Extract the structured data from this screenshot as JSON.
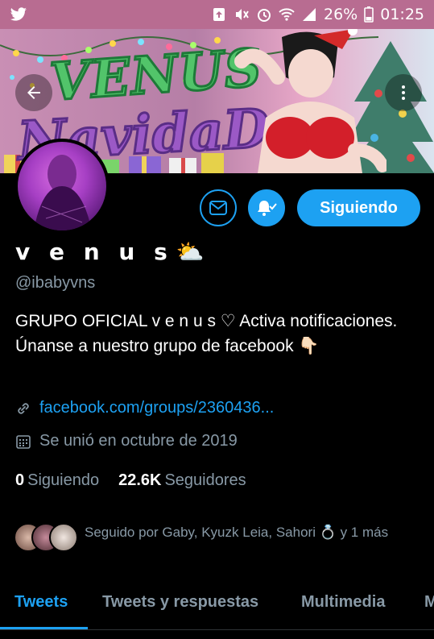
{
  "status_bar": {
    "battery": "26%",
    "time": "01:25",
    "icons": [
      "twitter-bird-icon",
      "upload-icon",
      "mute-icon",
      "alarm-icon",
      "wifi-icon",
      "signal-icon",
      "battery-icon"
    ]
  },
  "banner": {
    "title_line1": "VENUS",
    "title_line2": "NavidaD"
  },
  "profile": {
    "name": "v e n u s",
    "name_emoji": "⛅",
    "handle": "@ibabyvns",
    "bio": "GRUPO OFICIAL v e n u s ♡ Activa notificaciones. Únanse a nuestro grupo de facebook 👇🏻",
    "link": "facebook.com/groups/2360436...",
    "joined": "Se unió en octubre de 2019"
  },
  "actions": {
    "follow_label": "Siguiendo"
  },
  "counts": {
    "following_num": "0",
    "following_label": "Siguiendo",
    "followers_num": "22.6K",
    "followers_label": "Seguidores"
  },
  "followed_by": {
    "text": "Seguido por Gaby, Kyuzk Leia, Sahori 💍 y 1 más"
  },
  "tabs": [
    {
      "label": "Tweets",
      "active": true
    },
    {
      "label": "Tweets y respuestas",
      "active": false
    },
    {
      "label": "Multimedia",
      "active": false
    },
    {
      "label": "Me gusta",
      "active": false
    }
  ],
  "colors": {
    "accent": "#1da1f2",
    "secondary_text": "#8899a6",
    "status_bar": "#b86c91",
    "background": "#000000"
  }
}
